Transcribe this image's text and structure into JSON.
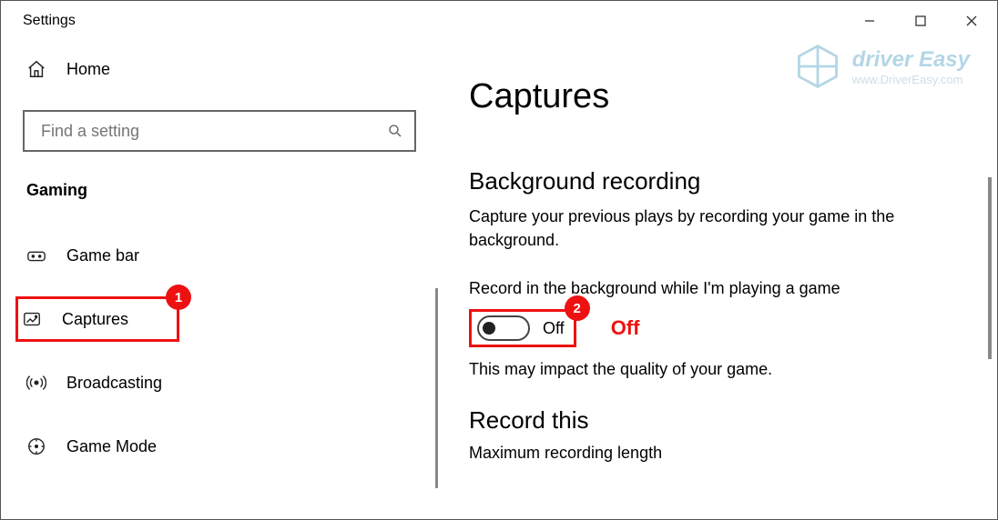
{
  "window": {
    "title": "Settings"
  },
  "sidebar": {
    "home_label": "Home",
    "search_placeholder": "Find a setting",
    "category": "Gaming",
    "items": [
      {
        "label": "Game bar"
      },
      {
        "label": "Captures"
      },
      {
        "label": "Broadcasting"
      },
      {
        "label": "Game Mode"
      }
    ]
  },
  "main": {
    "title": "Captures",
    "section1_title": "Background recording",
    "section1_desc": "Capture your previous plays by recording your game in the background.",
    "toggle_label": "Record in the background while I'm playing a game",
    "toggle_state": "Off",
    "toggle_note": "This may impact the quality of your game.",
    "section2_title": "Record this",
    "section2_sub": "Maximum recording length"
  },
  "annotations": {
    "badge1": "1",
    "badge2": "2",
    "off_text": "Off"
  },
  "watermark": {
    "brand": "driver Easy",
    "url": "www.DriverEasy.com"
  }
}
